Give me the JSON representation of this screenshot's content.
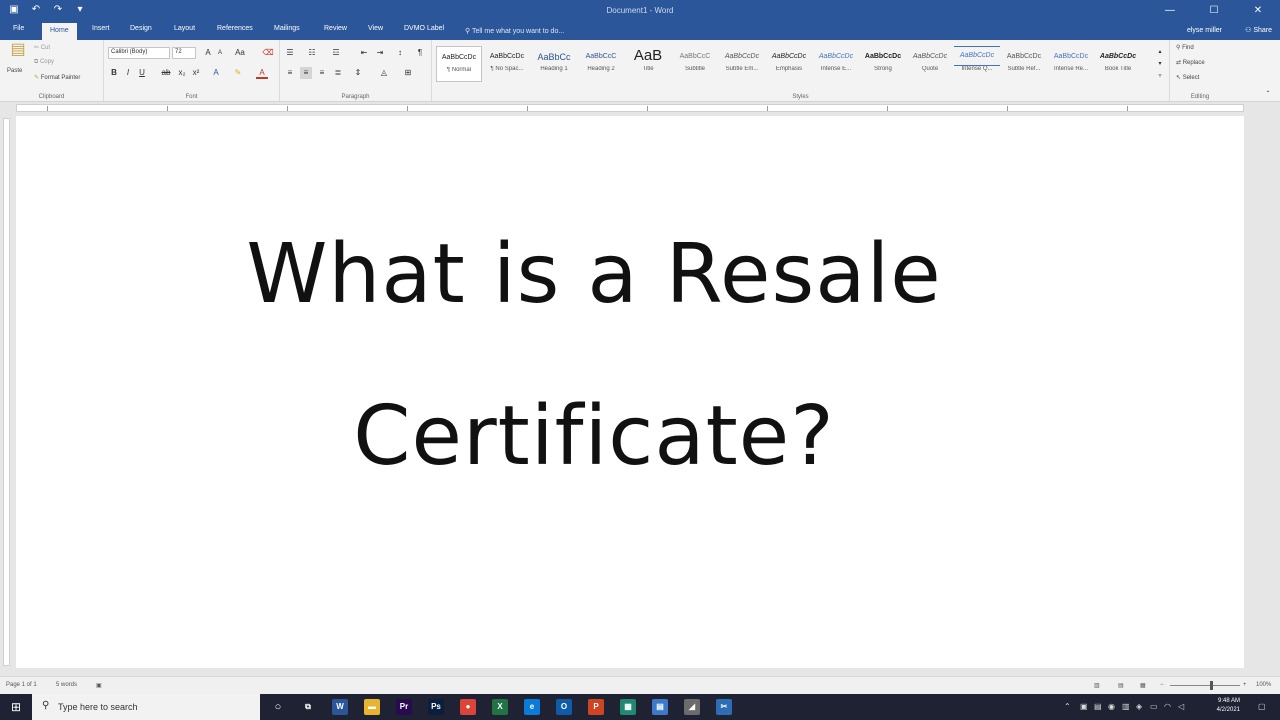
{
  "window": {
    "title": "Document1 - Word",
    "qat_icons": [
      "save-icon",
      "undo-icon",
      "redo-icon",
      "customize-icon"
    ],
    "controls": [
      "minimize-icon",
      "maximize-icon",
      "close-icon"
    ]
  },
  "tabs": [
    {
      "label": "File"
    },
    {
      "label": "Home",
      "active": true
    },
    {
      "label": "Insert"
    },
    {
      "label": "Design"
    },
    {
      "label": "Layout"
    },
    {
      "label": "References"
    },
    {
      "label": "Mailings"
    },
    {
      "label": "Review"
    },
    {
      "label": "View"
    },
    {
      "label": "DVMO Label"
    }
  ],
  "tell_me": "Tell me what you want to do...",
  "user_name": "elyse miller",
  "share_label": "Share",
  "clipboard": {
    "paste": "Paste",
    "cut": "Cut",
    "copy": "Copy",
    "format_painter": "Format Painter",
    "group_label": "Clipboard"
  },
  "font": {
    "name": "Calibri (Body)",
    "size": "72",
    "group_label": "Font"
  },
  "paragraph": {
    "group_label": "Paragraph"
  },
  "styles": {
    "group_label": "Styles",
    "items": [
      {
        "sample": "AaBbCcDc",
        "name": "¶ Normal"
      },
      {
        "sample": "AaBbCcDc",
        "name": "¶ No Spac..."
      },
      {
        "sample": "AaBbCc",
        "name": "Heading 1"
      },
      {
        "sample": "AaBbCcC",
        "name": "Heading 2"
      },
      {
        "sample": "AaB",
        "name": "Title"
      },
      {
        "sample": "AaBbCcC",
        "name": "Subtitle"
      },
      {
        "sample": "AaBbCcDc",
        "name": "Subtle Em..."
      },
      {
        "sample": "AaBbCcDc",
        "name": "Emphasis"
      },
      {
        "sample": "AaBbCcDc",
        "name": "Intense E..."
      },
      {
        "sample": "AaBbCcDc",
        "name": "Strong"
      },
      {
        "sample": "AaBbCcDc",
        "name": "Quote"
      },
      {
        "sample": "AaBbCcDc",
        "name": "Intense Q..."
      },
      {
        "sample": "AaBbCcDc",
        "name": "Subtle Ref..."
      },
      {
        "sample": "AaBbCcDc",
        "name": "Intense Re..."
      },
      {
        "sample": "AaBbCcDc",
        "name": "Book Title"
      }
    ]
  },
  "editing": {
    "find": "Find",
    "replace": "Replace",
    "select": "Select",
    "group_label": "Editing"
  },
  "document": {
    "line1": "What is a Resale",
    "line2": "Certificate?"
  },
  "status": {
    "page": "Page 1 of 1",
    "words": "5 words",
    "zoom": "100%"
  },
  "taskbar": {
    "search_placeholder": "Type here to search",
    "time": "9:48 AM",
    "date": "4/2/2021",
    "apps": [
      {
        "name": "task-view-icon",
        "color": "#1e2233",
        "glyph": "⧉"
      },
      {
        "name": "word-icon",
        "color": "#2b579a",
        "glyph": "W"
      },
      {
        "name": "file-explorer-icon",
        "color": "#e8b531",
        "glyph": "▬"
      },
      {
        "name": "premiere-icon",
        "color": "#2a0a4e",
        "glyph": "Pr"
      },
      {
        "name": "photoshop-icon",
        "color": "#0a1f3d",
        "glyph": "Ps"
      },
      {
        "name": "chrome-icon",
        "color": "#db4437",
        "glyph": "●"
      },
      {
        "name": "excel-icon",
        "color": "#217346",
        "glyph": "X"
      },
      {
        "name": "edge-icon",
        "color": "#0a7bd7",
        "glyph": "e"
      },
      {
        "name": "outlook-icon",
        "color": "#0f5ba8",
        "glyph": "O"
      },
      {
        "name": "powerpoint-icon",
        "color": "#d04423",
        "glyph": "P"
      },
      {
        "name": "photos-icon",
        "color": "#1f8a70",
        "glyph": "▦"
      },
      {
        "name": "calculator-icon",
        "color": "#3c79c8",
        "glyph": "▤"
      },
      {
        "name": "eraser-app-icon",
        "color": "#6b6b6b",
        "glyph": "◢"
      },
      {
        "name": "snip-tool-icon",
        "color": "#2d6db5",
        "glyph": "✂"
      }
    ]
  }
}
